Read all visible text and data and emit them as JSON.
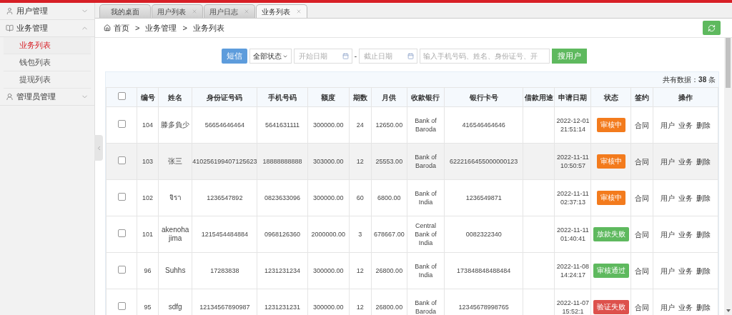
{
  "sidebar": {
    "groups": [
      {
        "label": "用户管理",
        "expanded": false
      },
      {
        "label": "业务管理",
        "expanded": true,
        "items": [
          {
            "label": "业务列表",
            "selected": true
          },
          {
            "label": "钱包列表",
            "selected": false
          },
          {
            "label": "提现列表",
            "selected": false
          }
        ]
      },
      {
        "label": "管理员管理",
        "expanded": false
      }
    ]
  },
  "tabs": [
    {
      "label": "我的桌面",
      "selected": false,
      "closable": false
    },
    {
      "label": "用户列表",
      "selected": false,
      "closable": true
    },
    {
      "label": "用户日志",
      "selected": false,
      "closable": true
    },
    {
      "label": "业务列表",
      "selected": true,
      "closable": true
    }
  ],
  "breadcrumb": [
    "首页",
    "业务管理",
    "业务列表"
  ],
  "breadcrumb_separator": ">",
  "toolbar": {
    "sms_button": "短信",
    "status_select": "全部状态",
    "start_date": {
      "placeholder": "开始日期"
    },
    "date_separator": "-",
    "end_date": {
      "placeholder": "截止日期"
    },
    "search": {
      "placeholder": "输入手机号码、姓名、身份证号、开"
    },
    "search_button": "搜用户"
  },
  "total": "共有数据：**38** 条",
  "table": {
    "all_checked": false,
    "columns": [
      "编号",
      "姓名",
      "身份证号码",
      "手机号码",
      "额度",
      "期数",
      "月供",
      "收款银行",
      "银行卡号",
      "借款用途",
      "申请日期",
      "状态",
      "签约",
      "操作"
    ],
    "rows": [
      {
        "checked": false,
        "hovered": false,
        "id": "104",
        "name": "滕多負少",
        "id_number": "56654646464",
        "phone": "5641631111",
        "amount": "300000.00",
        "periods": "24",
        "monthly": "12650.00",
        "bank": "Bank of Baroda",
        "card": "416546464646",
        "date": "2022-12-01 21:51:14",
        "status": "审核中",
        "color": "#f37b1d",
        "sign": "合同",
        "actions": [
          "用户",
          "业务",
          "删除"
        ]
      },
      {
        "checked": false,
        "hovered": true,
        "id": "103",
        "name": "张三",
        "id_number": "410256199407125623",
        "phone": "18888888888",
        "amount": "303000.00",
        "periods": "12",
        "monthly": "25553.00",
        "bank": "Bank of Baroda",
        "card": "6222166455000000123",
        "date": "2022-11-11 10:50:57",
        "status": "审核中",
        "color": "#f37b1d",
        "sign": "合同",
        "actions": [
          "用户",
          "业务",
          "删除"
        ]
      },
      {
        "checked": false,
        "hovered": false,
        "id": "102",
        "name": "จิรา",
        "id_number": "1236547892",
        "phone": "0823633096",
        "amount": "300000.00",
        "periods": "60",
        "monthly": "6800.00",
        "bank": "Bank of India",
        "card": "1236549871",
        "date": "2022-11-11 02:37:13",
        "status": "审核中",
        "color": "#f37b1d",
        "sign": "合同",
        "actions": [
          "用户",
          "业务",
          "删除"
        ]
      },
      {
        "checked": false,
        "hovered": false,
        "id": "101",
        "name": "akenoha jima",
        "id_number": "1215454484884",
        "phone": "0968126360",
        "amount": "2000000.00",
        "periods": "3",
        "monthly": "678667.00",
        "bank": "Central Bank of India",
        "card": "0082322340",
        "date": "2022-11-11 01:40:41",
        "status": "放款失败",
        "color": "#5eb95e",
        "sign": "合同",
        "actions": [
          "用户",
          "业务",
          "删除"
        ]
      },
      {
        "checked": false,
        "hovered": false,
        "id": "96",
        "name": "Suhhs",
        "id_number": "17283838",
        "phone": "1231231234",
        "amount": "300000.00",
        "periods": "12",
        "monthly": "26800.00",
        "bank": "Bank of India",
        "card": "173848848488484",
        "date": "2022-11-08 14:24:17",
        "status": "审核通过",
        "color": "#5eb95e",
        "sign": "合同",
        "actions": [
          "用户",
          "业务",
          "删除"
        ]
      },
      {
        "checked": false,
        "hovered": false,
        "id": "95",
        "name": "sdfg",
        "id_number": "12134567890987",
        "phone": "1231231231",
        "amount": "300000.00",
        "periods": "12",
        "monthly": "26800.00",
        "bank": "Bank of Baroda",
        "card": "12345678998765",
        "date": "2022-11-07 15:52:1",
        "status": "验证失败",
        "color": "#dd514c",
        "sign": "合同",
        "actions": [
          "用户",
          "业务",
          "删除"
        ]
      }
    ]
  }
}
